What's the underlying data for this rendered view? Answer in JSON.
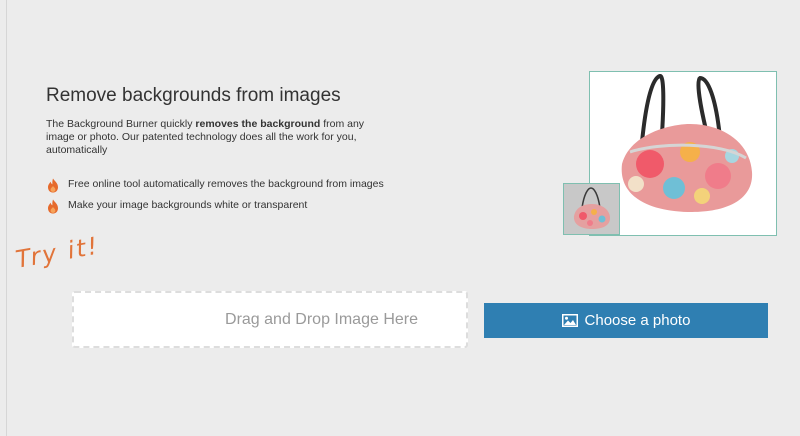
{
  "intro": {
    "heading": "Remove backgrounds from images",
    "lead_prefix": "The Background Burner quickly ",
    "lead_bold": "removes the background",
    "lead_suffix": " from any image or photo. Our patented technology does all the work for you, automatically"
  },
  "features": [
    {
      "text": "Free online tool automatically removes the background from images",
      "icon": "flame-icon"
    },
    {
      "text": "Make your image backgrounds white or transparent",
      "icon": "flame-icon"
    }
  ],
  "try_it": "Try it!",
  "upload": {
    "drop_text": "Drag and Drop Image Here",
    "choose_label": "Choose a photo",
    "choose_icon": "image-icon"
  },
  "colors": {
    "background": "#ececec",
    "accent_orange": "#e1743a",
    "button_blue": "#2f7fb2",
    "preview_border": "#7fbfb0"
  }
}
